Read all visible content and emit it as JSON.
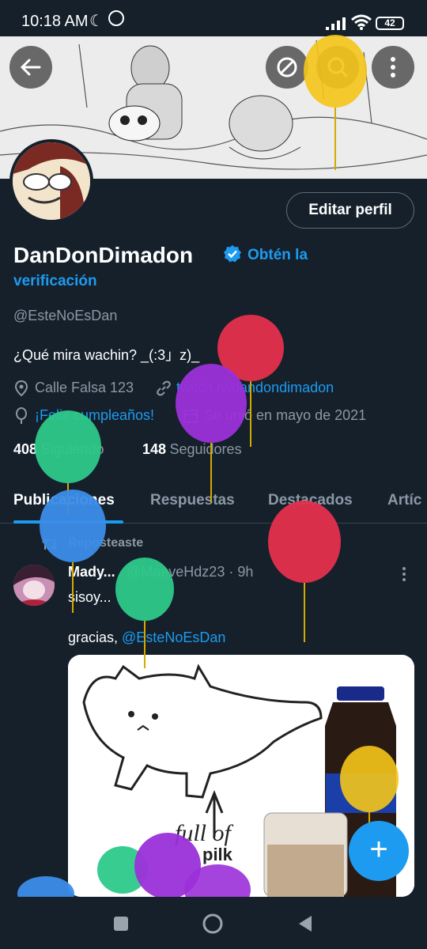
{
  "status_bar": {
    "time": "10:18 AM",
    "battery": "42"
  },
  "profile": {
    "display_name": "DanDonDimadon",
    "get_verified_line1": "Obtén la",
    "get_verified_line2": "verificación",
    "handle": "@EsteNoEsDan",
    "bio": "¿Qué mira wachin? _(:3」z)_",
    "location": "Calle Falsa 123",
    "website": "twitch.tv/dandondimadon",
    "birthday": "¡Feliz cumpleaños!",
    "joined": "Se unió en mayo de 2021",
    "following_count": "408",
    "following_label": "Siguiendo",
    "followers_count": "148",
    "followers_label": "Seguidores",
    "edit_button": "Editar perfil"
  },
  "tabs": [
    {
      "label": "Publicaciones",
      "active": true
    },
    {
      "label": "Respuestas",
      "active": false
    },
    {
      "label": "Destacados",
      "active": false
    },
    {
      "label": "Artíc",
      "active": false
    }
  ],
  "post": {
    "repost_label": "Reposteaste",
    "author": "Mady...",
    "handle_time": "@MaeveHdz23 · 9h",
    "text_line1": "sisoy...",
    "text_line2": "gracias, ",
    "mention": "@EsteNoEsDan",
    "image_text1": "full of",
    "image_text2": "pilk"
  },
  "fab_label": "+",
  "colors": {
    "accent": "#1d9bf0",
    "background": "#15202b",
    "muted": "#8b98a5"
  }
}
